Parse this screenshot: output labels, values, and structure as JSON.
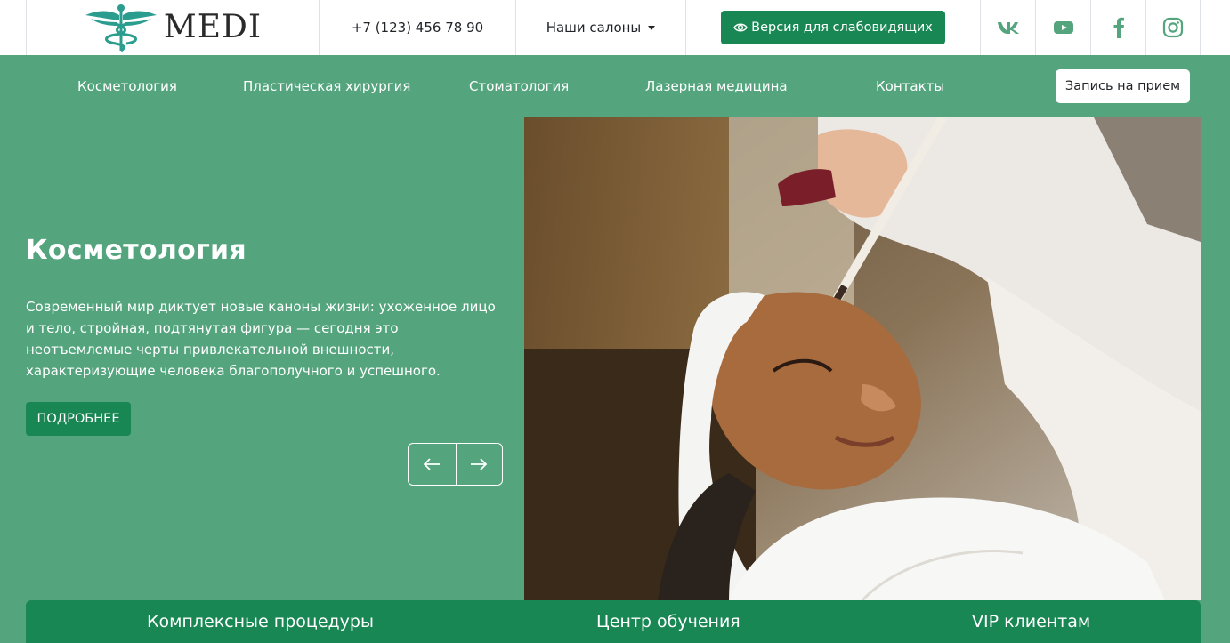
{
  "header": {
    "logo_text": "MEDI",
    "phone": "+7 (123) 456 78 90",
    "salons_label": "Наши салоны",
    "vision_label": "Версия для слабовидящих",
    "social": [
      {
        "name": "vk-icon"
      },
      {
        "name": "youtube-icon"
      },
      {
        "name": "facebook-icon"
      },
      {
        "name": "instagram-icon"
      }
    ]
  },
  "nav": {
    "items": [
      {
        "label": "Косметология"
      },
      {
        "label": "Пластическая хирургия"
      },
      {
        "label": "Стоматология"
      },
      {
        "label": "Лазерная медицина"
      },
      {
        "label": "Контакты"
      }
    ],
    "appointment_label": "Запись на прием"
  },
  "hero": {
    "title": "Косметология",
    "text": "Современный мир диктует новые каноны жизни: ухоженное лицо и тело, стройная, подтянутая фигура — сегодня это неотъемлемые черты привлекательной внешности, характеризующие человека благополучного и успешного.",
    "more_label": "ПОДРОБНЕЕ"
  },
  "bottom_tabs": [
    {
      "label": "Комплексные процедуры"
    },
    {
      "label": "Центр обучения"
    },
    {
      "label": "VIP клиентам"
    }
  ],
  "colors": {
    "accent_green": "#198754",
    "hero_bg": "#54a57e",
    "social_icon": "#54a57e",
    "logo_teal": "#2a9d8f"
  }
}
